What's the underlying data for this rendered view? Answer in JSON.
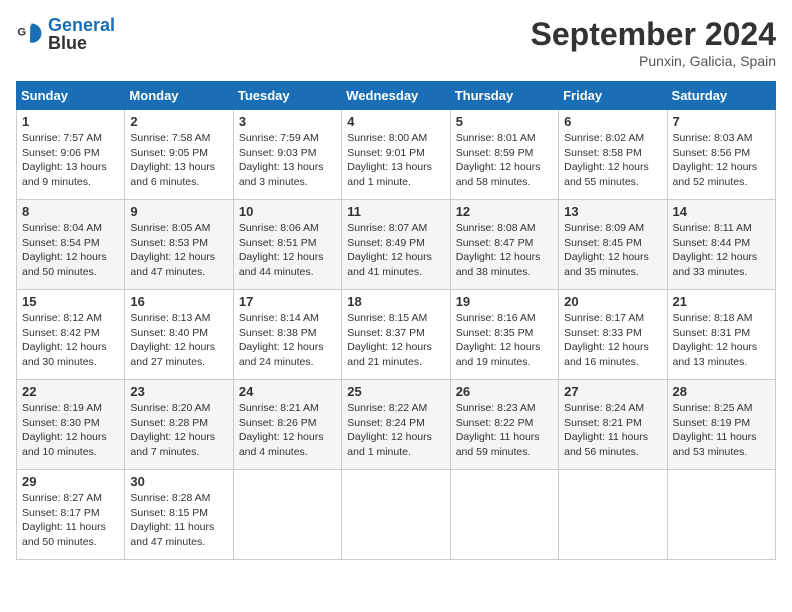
{
  "header": {
    "logo_line1": "General",
    "logo_line2": "Blue",
    "month_title": "September 2024",
    "subtitle": "Punxin, Galicia, Spain"
  },
  "weekdays": [
    "Sunday",
    "Monday",
    "Tuesday",
    "Wednesday",
    "Thursday",
    "Friday",
    "Saturday"
  ],
  "weeks": [
    [
      {
        "day": "1",
        "sunrise": "7:57 AM",
        "sunset": "9:06 PM",
        "daylight": "13 hours and 9 minutes."
      },
      {
        "day": "2",
        "sunrise": "7:58 AM",
        "sunset": "9:05 PM",
        "daylight": "13 hours and 6 minutes."
      },
      {
        "day": "3",
        "sunrise": "7:59 AM",
        "sunset": "9:03 PM",
        "daylight": "13 hours and 3 minutes."
      },
      {
        "day": "4",
        "sunrise": "8:00 AM",
        "sunset": "9:01 PM",
        "daylight": "13 hours and 1 minute."
      },
      {
        "day": "5",
        "sunrise": "8:01 AM",
        "sunset": "8:59 PM",
        "daylight": "12 hours and 58 minutes."
      },
      {
        "day": "6",
        "sunrise": "8:02 AM",
        "sunset": "8:58 PM",
        "daylight": "12 hours and 55 minutes."
      },
      {
        "day": "7",
        "sunrise": "8:03 AM",
        "sunset": "8:56 PM",
        "daylight": "12 hours and 52 minutes."
      }
    ],
    [
      {
        "day": "8",
        "sunrise": "8:04 AM",
        "sunset": "8:54 PM",
        "daylight": "12 hours and 50 minutes."
      },
      {
        "day": "9",
        "sunrise": "8:05 AM",
        "sunset": "8:53 PM",
        "daylight": "12 hours and 47 minutes."
      },
      {
        "day": "10",
        "sunrise": "8:06 AM",
        "sunset": "8:51 PM",
        "daylight": "12 hours and 44 minutes."
      },
      {
        "day": "11",
        "sunrise": "8:07 AM",
        "sunset": "8:49 PM",
        "daylight": "12 hours and 41 minutes."
      },
      {
        "day": "12",
        "sunrise": "8:08 AM",
        "sunset": "8:47 PM",
        "daylight": "12 hours and 38 minutes."
      },
      {
        "day": "13",
        "sunrise": "8:09 AM",
        "sunset": "8:45 PM",
        "daylight": "12 hours and 35 minutes."
      },
      {
        "day": "14",
        "sunrise": "8:11 AM",
        "sunset": "8:44 PM",
        "daylight": "12 hours and 33 minutes."
      }
    ],
    [
      {
        "day": "15",
        "sunrise": "8:12 AM",
        "sunset": "8:42 PM",
        "daylight": "12 hours and 30 minutes."
      },
      {
        "day": "16",
        "sunrise": "8:13 AM",
        "sunset": "8:40 PM",
        "daylight": "12 hours and 27 minutes."
      },
      {
        "day": "17",
        "sunrise": "8:14 AM",
        "sunset": "8:38 PM",
        "daylight": "12 hours and 24 minutes."
      },
      {
        "day": "18",
        "sunrise": "8:15 AM",
        "sunset": "8:37 PM",
        "daylight": "12 hours and 21 minutes."
      },
      {
        "day": "19",
        "sunrise": "8:16 AM",
        "sunset": "8:35 PM",
        "daylight": "12 hours and 19 minutes."
      },
      {
        "day": "20",
        "sunrise": "8:17 AM",
        "sunset": "8:33 PM",
        "daylight": "12 hours and 16 minutes."
      },
      {
        "day": "21",
        "sunrise": "8:18 AM",
        "sunset": "8:31 PM",
        "daylight": "12 hours and 13 minutes."
      }
    ],
    [
      {
        "day": "22",
        "sunrise": "8:19 AM",
        "sunset": "8:30 PM",
        "daylight": "12 hours and 10 minutes."
      },
      {
        "day": "23",
        "sunrise": "8:20 AM",
        "sunset": "8:28 PM",
        "daylight": "12 hours and 7 minutes."
      },
      {
        "day": "24",
        "sunrise": "8:21 AM",
        "sunset": "8:26 PM",
        "daylight": "12 hours and 4 minutes."
      },
      {
        "day": "25",
        "sunrise": "8:22 AM",
        "sunset": "8:24 PM",
        "daylight": "12 hours and 1 minute."
      },
      {
        "day": "26",
        "sunrise": "8:23 AM",
        "sunset": "8:22 PM",
        "daylight": "11 hours and 59 minutes."
      },
      {
        "day": "27",
        "sunrise": "8:24 AM",
        "sunset": "8:21 PM",
        "daylight": "11 hours and 56 minutes."
      },
      {
        "day": "28",
        "sunrise": "8:25 AM",
        "sunset": "8:19 PM",
        "daylight": "11 hours and 53 minutes."
      }
    ],
    [
      {
        "day": "29",
        "sunrise": "8:27 AM",
        "sunset": "8:17 PM",
        "daylight": "11 hours and 50 minutes."
      },
      {
        "day": "30",
        "sunrise": "8:28 AM",
        "sunset": "8:15 PM",
        "daylight": "11 hours and 47 minutes."
      },
      null,
      null,
      null,
      null,
      null
    ]
  ]
}
